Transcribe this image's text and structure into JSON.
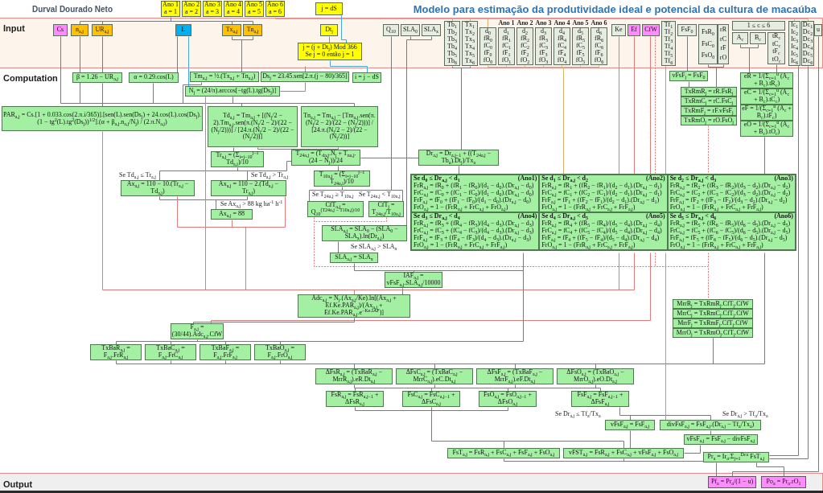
{
  "header": {
    "author": "Durval Dourado Neto",
    "title": "Modelo para estimação da produtividade ideal e potencial da cultura de macaúba"
  },
  "input": {
    "label": "Input",
    "year_labels": [
      "Ano 1",
      "Ano 2",
      "Ano 3",
      "Ano 4",
      "Ano 5",
      "Ano 6"
    ],
    "nodes": [
      {
        "lines": [
          "Ano 1",
          "a = 1"
        ],
        "color": "#ffff00"
      },
      {
        "lines": [
          "Ano 2",
          "a = 2"
        ],
        "color": "#ffff00"
      },
      {
        "lines": [
          "Ano 3",
          "a = 3"
        ],
        "color": "#ffff00"
      },
      {
        "lines": [
          "Ano 4",
          "a = 4"
        ],
        "color": "#ffff00"
      },
      {
        "lines": [
          "Ano 5",
          "a = 5"
        ],
        "color": "#ffff00"
      },
      {
        "lines": [
          "Ano 6",
          "a = 6"
        ],
        "color": "#ffff00"
      },
      {
        "lines": [
          "j = dS"
        ],
        "color": "#ffff00"
      },
      {
        "lines": [
          "Cs"
        ],
        "color": "#ff8cff"
      },
      {
        "lines": [
          "n$_{a,j}$"
        ],
        "color": "#ffc000"
      },
      {
        "lines": [
          "UR$_{a,j}$"
        ],
        "color": "#ffc000"
      },
      {
        "lines": [
          "L"
        ],
        "color": "#00b0f0"
      },
      {
        "lines": [
          "Tx$_{a,j}$"
        ],
        "color": "#ffc000"
      },
      {
        "lines": [
          "Tn$_{a,j}$"
        ],
        "color": "#ffc000"
      },
      {
        "lines": [
          "Dt$_{j}$"
        ],
        "color": "#ffff00"
      },
      {
        "lines": [
          "j = (j + Dt$_{j}$) Mod 366",
          "Se j = 0 então j = 1"
        ],
        "color": "#ffff00"
      },
      {
        "lines": [
          "Q$_{10}$"
        ],
        "color": "#e6ede0"
      },
      {
        "lines": [
          "SLA$_{0}$"
        ],
        "color": "#e6ede0"
      },
      {
        "lines": [
          "SLA$_{x}$"
        ],
        "color": "#e6ede0"
      },
      {
        "lines": [
          "Tb$_{1}$",
          "Tb$_{2}$",
          "Tb$_{3}$",
          "Tb$_{4}$",
          "Tb$_{5}$",
          "Tb$_{6}$"
        ],
        "color": "#e6ede0"
      },
      {
        "lines": [
          "Tx$_{1}$",
          "Tx$_{2}$",
          "Tx$_{3}$",
          "Tx$_{4}$",
          "Tx$_{5}$",
          "Tx$_{6}$"
        ],
        "color": "#e6ede0"
      },
      {
        "lines": [
          "d$_{0}$",
          "fR$_{0}$",
          "fC$_{0}$",
          "fF$_{0}$",
          "fO$_{0}$"
        ],
        "color": "#e6ede0"
      },
      {
        "lines": [
          "d$_{1}$",
          "fR$_{1}$",
          "fC$_{1}$",
          "fF$_{1}$",
          "fO$_{1}$"
        ],
        "color": "#e6ede0"
      },
      {
        "lines": [
          "d$_{2}$",
          "fR$_{2}$",
          "fC$_{2}$",
          "fF$_{2}$",
          "fO$_{2}$"
        ],
        "color": "#e6ede0"
      },
      {
        "lines": [
          "d$_{3}$",
          "fR$_{3}$",
          "fC$_{3}$",
          "fF$_{3}$",
          "fO$_{3}$"
        ],
        "color": "#e6ede0"
      },
      {
        "lines": [
          "d$_{4}$",
          "fR$_{4}$",
          "fC$_{4}$",
          "fF$_{4}$",
          "fO$_{4}$"
        ],
        "color": "#e6ede0"
      },
      {
        "lines": [
          "d$_{5}$",
          "fR$_{5}$",
          "fC$_{5}$",
          "fF$_{5}$",
          "fO$_{5}$"
        ],
        "color": "#e6ede0"
      },
      {
        "lines": [
          "d$_{6}$",
          "fR$_{6}$",
          "fC$_{6}$",
          "fF$_{6}$",
          "fO$_{6}$"
        ],
        "color": "#e6ede0"
      },
      {
        "lines": [
          "Ke"
        ],
        "color": "#e6ede0"
      },
      {
        "lines": [
          "Ef"
        ],
        "color": "#ff8cff"
      },
      {
        "lines": [
          "CfW"
        ],
        "color": "#ff8cff"
      },
      {
        "lines": [
          "Tf$_{1}$",
          "Tf$_{2}$",
          "Tf$_{3}$",
          "Tf$_{4}$",
          "Tf$_{5}$",
          "Tf$_{6}$"
        ],
        "color": "#e6ede0"
      },
      {
        "lines": [
          "FsF$_{0}$"
        ],
        "color": "#e6ede0"
      },
      {
        "lines": [
          "FsR$_{0}$",
          "FsC$_{0}$",
          "FsO$_{0}$"
        ],
        "color": "#e6ede0"
      },
      {
        "lines": [
          "rR",
          "rC",
          "rF",
          "rO"
        ],
        "color": "#e6ede0"
      },
      {
        "lines": [
          "1 ≤ c ≤ 6"
        ],
        "color": "#e6ede0"
      },
      {
        "lines": [
          "A$_{c}$"
        ],
        "color": "#e6ede0"
      },
      {
        "lines": [
          "B$_{c}$"
        ],
        "color": "#e6ede0"
      },
      {
        "lines": [
          "tR$_{c}$",
          "tC$_{c}$",
          "tF$_{c}$",
          "tO$_{c}$"
        ],
        "color": "#e6ede0"
      },
      {
        "lines": [
          "Ic$_{1}$",
          "Ic$_{2}$",
          "Ic$_{3}$",
          "Ic$_{4}$",
          "Ic$_{5}$",
          "Ic$_{6}$"
        ],
        "color": "#e6ede0"
      },
      {
        "lines": [
          "Dc$_{1}$",
          "Dc$_{2}$",
          "Dc$_{3}$",
          "Dc$_{4}$",
          "Dc$_{5}$",
          "Dc$_{6}$"
        ],
        "color": "#e6ede0"
      },
      {
        "lines": [
          "u"
        ],
        "color": "#e6ede0"
      }
    ]
  },
  "computation": {
    "label": "Computation",
    "nodes": [
      {
        "lines": [
          "β = 1.26 − UR$_{a,j}$"
        ]
      },
      {
        "lines": [
          "α = 0.29.cos(L)"
        ]
      },
      {
        "lines": [
          "Tm$_{a,j}$ = ½.(Tx$_{a,j}$ + Tn$_{a,j}$)"
        ]
      },
      {
        "lines": [
          "Ds$_{j}$ = 23.45.sen[2.π.(j − 80)/365]"
        ]
      },
      {
        "lines": [
          "i = j − dS"
        ]
      },
      {
        "lines": [
          "N$_{j}$ = (24/π).arccos[−tg(L).tg(Ds$_{j}$)]"
        ]
      },
      {
        "lines": [
          "PAR$_{a,j}$ = Cs.[1 + 0.033.cos(2.π.i/365)].[sen(L).sen(Ds$_{j}$) + 24.cos(L).cos(Ds$_{j}$).(1 − tg$^{2}$(L).tg$^{2}$(Ds$_{j}$))$^{1/2}$].(α + β$_{a,j}$.n$_{a,j}$/N$_{j}$) / (2.π.N$_{a,j}$)"
        ]
      },
      {
        "lines": [
          "Td$_{a,j}$ = Tm$_{a,j}$ + [(N$_{j}$/2 − 2).Tm$_{a,j}$.sen(π.(N$_{j}$/2 − 2)/(22 − (N$_{j}$/2)))] / [24.π.(N$_{j}$/2 − 2)/(22 − (N$_{j}$/2))]"
        ]
      },
      {
        "lines": [
          "Tn$_{a,j}$ = Tm$_{a,j}$ − [Tm$_{a,j}$.sen(π.(N$_{j}$/2 − 2)/(22 − (N$_{j}$/2)))] / [24.π.(N$_{j}$/2 − 2)/(22 − (N$_{j}$/2))]"
        ]
      },
      {
        "lines": [
          "Tr$_{a,j}$ = (Σ$_{i=j−10}$$^{j−1}$ Td$_{a,i}$)/10"
        ]
      },
      {
        "lines": [
          "T$_{24a,j}$ = (T$_{da,j}$.N$_{j}$ + T$_{na,j}$.(24 − N$_{j}$))/24"
        ]
      },
      {
        "lines": [
          "T$_{10a,j}$ = (Σ$_{i=j−10}$$^{j−1}$ T$_{24a,i}$)/10"
        ]
      },
      {
        "lines": [
          "Ax$_{a,j}$ = 110 − 10.(Tr$_{a,j}$ − Td$_{a,j}$)"
        ]
      },
      {
        "lines": [
          "Ax$_{a,j}$ = 110 − 2.(Td$_{a,j}$ − Tr$_{a,j}$)"
        ]
      },
      {
        "lines": [
          "Ax$_{a,j}$ = 88"
        ]
      },
      {
        "lines": [
          "Dr$_{a,j}$ = Dr$_{a,j−1}$ + ((T$_{24a,j}$ − Tb$_{a}$).Dt$_{j}$)/Tx$_{a}$"
        ]
      },
      {
        "lines": [
          "CfT$_{a,j}$ = Q$_{10}$$^{(T24a,j − T10a,j)/10}$"
        ]
      },
      {
        "lines": [
          "CfT$_{j}$ = T$_{24a,j}$/T$_{10a,j}$"
        ]
      },
      {
        "lines": [
          "SLA$_{a,j}$ = SLA$_{0}$ − (SLA$_{0}$ − SLA$_{x}$).ln(Dr$_{a,j}$)"
        ]
      },
      {
        "lines": [
          "SLA$_{a,j}$ = SLA$_{x}$"
        ]
      },
      {
        "lines": [
          "IAF$_{a,j}$ = vFsF$_{a,j}$.SLA$_{a,j}$/10000"
        ]
      },
      {
        "lines": [
          "Adc$_{a,j}$ = N$_{j}$.(Ax$_{a,j}$/Ke).ln[(Ax$_{a,j}$ + Ef.Ke.PAR$_{a,j}$)/(Ax$_{a,j}$ + Ef.Ke.PAR$_{a,j}$.e$^{−Ke.IAF}$)]"
        ]
      },
      {
        "lines": [
          "F$_{a,j}$ = (30/44).Adc$_{a,j}$.CfW"
        ]
      },
      {
        "lines": [
          "TxBaR$_{a,j}$ = F$_{a,j}$.FrR$_{a,j}$"
        ]
      },
      {
        "lines": [
          "TxBaC$_{a,j}$ = F$_{a,j}$.FrC$_{a,j}$"
        ]
      },
      {
        "lines": [
          "TxBaF$_{a,j}$ = F$_{a,j}$.FrF$_{a,j}$"
        ]
      },
      {
        "lines": [
          "TxBaO$_{a,j}$ = F$_{a,j}$.FrO$_{a,j}$"
        ]
      },
      {
        "lines": [
          "vFsF$_{j}$ = FsF$_{0}$"
        ]
      },
      {
        "lines": [
          "TxRmR$_{j}$ = rR.FsR$_{j}$"
        ]
      },
      {
        "lines": [
          "TxRmC$_{j}$ = rC.FsC$_{j}$"
        ]
      },
      {
        "lines": [
          "TxRmF$_{j}$ = rF.vFsF$_{j}$"
        ]
      },
      {
        "lines": [
          "TxRmO$_{j}$ = rO.FsO$_{j}$"
        ]
      },
      {
        "lines": [
          "eR = 1/(Σ$_{c=1}$$^{u}$ (A$_{c}$ + B$_{c}$).tR$_{c}$)"
        ]
      },
      {
        "lines": [
          "eC = 1/(Σ$_{c=1}$$^{u}$ (A$_{c}$ + B$_{c}$).tC$_{c}$)"
        ]
      },
      {
        "lines": [
          "eF = 1/(Σ$_{c=1}$$^{u}$ (A$_{c}$ + B$_{c}$).tF$_{c}$)"
        ]
      },
      {
        "lines": [
          "eO = 1/(Σ$_{c=1}$$^{u}$ (A$_{c}$ + B$_{c}$).tO$_{c}$)"
        ]
      },
      {
        "lines": [
          "MrrR$_{j}$ = TxRmR$_{j}$.CfT$_{j}$.CfW"
        ]
      },
      {
        "lines": [
          "MrrC$_{j}$ = TxRmC$_{j}$.CfT$_{j}$.CfW"
        ]
      },
      {
        "lines": [
          "MrrF$_{j}$ = TxRmF$_{j}$.CfT$_{j}$.CfW"
        ]
      },
      {
        "lines": [
          "MrrO$_{j}$ = TxRmO$_{j}$.CfT$_{j}$.CfW"
        ]
      },
      {
        "lines": [
          "ΔFsR$_{a,j}$ = (TxBaR$_{a,j}$ − MrrR$_{a,j}$).eR.Dt$_{a,j}$"
        ]
      },
      {
        "lines": [
          "ΔFsC$_{a,j}$ = (TxBaC$_{a,j}$ − MrrC$_{a,j}$).eC.Dt$_{a,j}$"
        ]
      },
      {
        "lines": [
          "ΔFsF$_{a,j}$ = (TxBaF$_{a,j}$ − MrrF$_{a,j}$).eF.Dt$_{a,j}$"
        ]
      },
      {
        "lines": [
          "ΔFsO$_{a,j}$ = (TxBaO$_{a,j}$ − MrrO$_{a,j}$).eO.Dt$_{a,j}$"
        ]
      },
      {
        "lines": [
          "FsR$_{a,j}$ = FsR$_{a,j−1}$ + ΔFsR$_{a,j}$"
        ]
      },
      {
        "lines": [
          "FsC$_{a,j}$ = FsC$_{a,j−1}$ + ΔFsC$_{a,j}$"
        ]
      },
      {
        "lines": [
          "FsO$_{a,j}$ = FsO$_{a,j−1}$ + ΔFsO$_{a,j}$"
        ]
      },
      {
        "lines": [
          "FsF$_{a,j}$ = FsF$_{a,j−1}$ + ΔFsF$_{a,j}$"
        ]
      },
      {
        "lines": [
          "vFsF$_{a,j}$ = FsF$_{a,j}$"
        ]
      },
      {
        "lines": [
          "divFsF$_{a,j}$ = FsF$_{a,j}$.(Dr$_{a,j}$ − Tf$_{a}$/Tx$_{a}$)"
        ]
      },
      {
        "lines": [
          "vFsF$_{a,j}$ = FsF$_{a,j}$ − divFsF$_{a,j}$"
        ]
      },
      {
        "lines": [
          "FsT$_{a,j}$ = FsR$_{a,j}$ + FsC$_{a,j}$ + FsF$_{a,j}$ + FsO$_{a,j}$"
        ]
      },
      {
        "lines": [
          "vFST$_{a,j}$ = FsR$_{a,j}$ + FsC$_{a,j}$ + vFsF$_{a,j}$ + FsO$_{a,j}$"
        ]
      },
      {
        "lines": [
          "Pr$_{a}$ = Ir$_{a}$.Σ$_{j=1}$$^{Dca}$ FsT$_{a,j}$"
        ]
      }
    ],
    "conditions": [
      "Se Td$_{a,j}$ ≤ Tr$_{a,j}$",
      "Se Td$_{a,j}$ > Tr$_{a,j}$",
      "Se Ax$_{a,j}$ > 88 kg ha$^{-1}$ h$^{-1}$",
      "Se T$_{24a,j}$ ≥ T$_{10a,j}$",
      "Se T$_{24a,j}$ < T$_{10a,j}$",
      "Se SLA$_{a,j}$ > SLA$_{x}$",
      "Se Dr$_{a,j}$ ≤ Tf$_{a}$/Tx$_{a}$",
      "Se Dr$_{a,j}$ > Tf$_{a}$/Tx$_{a}$"
    ],
    "fraction_table": [
      {
        "condition": "Se d$_{0}$ ≤ Dr$_{a,j}$ < d$_{1}$",
        "year": "(Ano1)",
        "formulas": [
          "FrR$_{a,j}$ = fR$_{0}$ + (fR$_{1}$ − fR$_{0}$)/(d$_{1}$ − d$_{0}$).(Dr$_{a,j}$ − d$_{0}$)",
          "FrC$_{a,j}$ = fC$_{0}$ + (fC$_{1}$ − fC$_{0}$)/(d$_{1}$ − d$_{0}$).(Dr$_{a,j}$ − d$_{0}$)",
          "FrF$_{a,j}$ = fF$_{0}$ + (fF$_{1}$ − fF$_{0}$)/(d$_{1}$ − d$_{0}$).(Dr$_{a,j}$ − d$_{0}$)",
          "FrO$_{a,j}$ = 1 − (FrR$_{a,j}$ + FrC$_{a,j}$ + FrO$_{a,j}$)"
        ]
      },
      {
        "condition": "Se d$_{1}$ ≤ Dr$_{a,j}$ < d$_{2}$",
        "year": "(Ano2)",
        "formulas": [
          "FrR$_{a,j}$ = fR$_{1}$ + (fR$_{2}$ − fR$_{1}$)/(d$_{2}$ − d$_{1}$).(Dr$_{a,j}$ − d$_{1}$)",
          "FrC$_{a,j}$ = fC$_{1}$ + (fC$_{2}$ − fC$_{1}$)/(d$_{2}$ − d$_{1}$).(Dr$_{a,j}$ − d$_{1}$)",
          "FrF$_{a,j}$ = fF$_{1}$ + (fF$_{2}$ − fF$_{1}$)/(d$_{2}$ − d$_{1}$).(Dr$_{a,j}$ − d$_{1}$)",
          "FrO$_{a,j}$ = 1 − (FrR$_{a,j}$ + FrC$_{a,j}$ + FrF$_{a,j}$)"
        ]
      },
      {
        "condition": "Se d$_{2}$ ≤ Dr$_{a,j}$ < d$_{3}$",
        "year": "(Ano3)",
        "formulas": [
          "FrR$_{a,j}$ = fR$_{2}$ + (fR$_{3}$ − fR$_{2}$)/(d$_{3}$ − d$_{2}$).(Dr$_{a,j}$ − d$_{2}$)",
          "FrC$_{a,j}$ = fC$_{2}$ + (fC$_{3}$ − fC$_{2}$)/(d$_{3}$ − d$_{2}$).(Dr$_{a,j}$ − d$_{2}$)",
          "FrF$_{a,j}$ = fF$_{2}$ + (fF$_{3}$ − fF$_{2}$)/(d$_{3}$ − d$_{2}$).(Dr$_{a,j}$ − d$_{2}$)",
          "FrO$_{a,j}$ = 1 − (FrR$_{a,j}$ + FrC$_{a,j}$ + FrF$_{a,j}$)"
        ]
      },
      {
        "condition": "Se d$_{3}$ ≤ Dr$_{a,j}$ < d$_{4}$",
        "year": "(Ano4)",
        "formulas": [
          "FrR$_{a,j}$ = fR$_{3}$ + (fR$_{4}$ − fR$_{3}$)/(d$_{4}$ − d$_{3}$).(Dr$_{a,j}$ − d$_{3}$)",
          "FrC$_{a,j}$ = fC$_{3}$ + (fC$_{4}$ − fC$_{3}$)/(d$_{4}$ − d$_{3}$).(Dr$_{a,j}$ − d$_{3}$)",
          "FrF$_{a,j}$ = fF$_{3}$ + (fF$_{4}$ − fF$_{3}$)/(d$_{4}$ − d$_{3}$).(Dr$_{a,j}$ − d$_{3}$)",
          "FrO$_{a,j}$ = 1 − (FrR$_{a,j}$ + FrC$_{a,j}$ + FrF$_{a,j}$)"
        ]
      },
      {
        "condition": "Se d$_{4}$ ≤ Dr$_{a,j}$ < d$_{5}$",
        "year": "(Ano5)",
        "formulas": [
          "FrR$_{a,j}$ = fR$_{4}$ + (fR$_{5}$ − fR$_{4}$)/(d$_{5}$ − d$_{4}$).(Dr$_{a,j}$ − d$_{4}$)",
          "FrC$_{a,j}$ = fC$_{4}$ + (fC$_{5}$ − fC$_{4}$)/(d$_{5}$ − d$_{4}$).(Dr$_{a,j}$ − d$_{4}$)",
          "FrF$_{a,j}$ = fF$_{4}$ + (fF$_{5}$ − fF$_{4}$)/(d$_{5}$ − d$_{4}$).(Dr$_{a,j}$ − d$_{4}$)",
          "FrO$_{a,j}$ = 1 − (FrR$_{a,j}$ + FrC$_{a,j}$ + FrF$_{a,j}$)"
        ]
      },
      {
        "condition": "Se d$_{5}$ ≤ Dr$_{a,j}$ < d$_{6}$",
        "year": "(Ano6)",
        "formulas": [
          "FrR$_{a,j}$ = fR$_{5}$ + (fR$_{6}$ − fR$_{5}$)/(d$_{6}$ − d$_{5}$).(Dr$_{a,j}$ − d$_{5}$)",
          "FrC$_{a,j}$ = fC$_{5}$ + (fC$_{6}$ − fC$_{5}$)/(d$_{6}$ − d$_{5}$).(Dr$_{a,j}$ − d$_{5}$)",
          "FrF$_{a,j}$ = fF$_{5}$ + (fF$_{6}$ − fF$_{5}$)/(d$_{6}$ − d$_{5}$).(Dr$_{a,j}$ − d$_{5}$)",
          "FrO$_{a,j}$ = 1 − (FrR$_{a,j}$ + FrC$_{a,j}$ + FrF$_{a,j}$)"
        ]
      }
    ]
  },
  "output": {
    "label": "Output",
    "nodes": [
      {
        "lines": [
          "Pf$_{a}$ = Pr$_{a}$/(1 − u)"
        ]
      },
      {
        "lines": [
          "Po$_{a}$ = Pr$_{a}$.rO$_{1}$"
        ]
      }
    ]
  }
}
